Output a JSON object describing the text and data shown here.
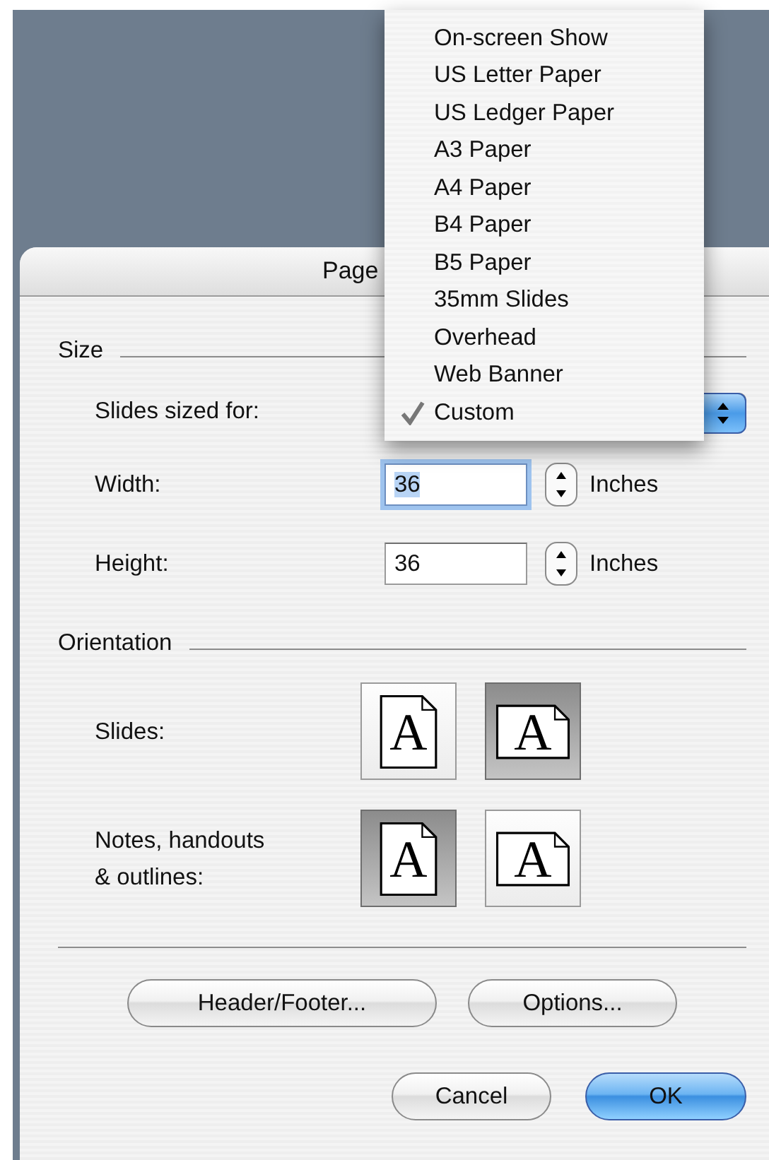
{
  "window": {
    "title": "Page"
  },
  "size_section": {
    "label": "Size",
    "slides_sized_for": {
      "label": "Slides sized for:"
    },
    "width": {
      "label": "Width:",
      "value": "36",
      "unit": "Inches",
      "focused": true
    },
    "height": {
      "label": "Height:",
      "value": "36",
      "unit": "Inches",
      "focused": false
    }
  },
  "size_menu": {
    "items": [
      {
        "label": "On-screen Show",
        "selected": false
      },
      {
        "label": "US Letter Paper",
        "selected": false
      },
      {
        "label": "US Ledger Paper",
        "selected": false
      },
      {
        "label": "A3 Paper",
        "selected": false
      },
      {
        "label": "A4 Paper",
        "selected": false
      },
      {
        "label": "B4 Paper",
        "selected": false
      },
      {
        "label": "B5 Paper",
        "selected": false
      },
      {
        "label": "35mm Slides",
        "selected": false
      },
      {
        "label": "Overhead",
        "selected": false
      },
      {
        "label": "Web Banner",
        "selected": false
      },
      {
        "label": "Custom",
        "selected": true
      }
    ]
  },
  "orientation": {
    "label": "Orientation",
    "rows": [
      {
        "label": "Slides:",
        "options": [
          {
            "kind": "portrait",
            "glyph": "A",
            "selected": false
          },
          {
            "kind": "landscape",
            "glyph": "A",
            "selected": true
          }
        ]
      },
      {
        "label": "Notes, handouts\n& outlines:",
        "options": [
          {
            "kind": "portrait",
            "glyph": "A",
            "selected": true
          },
          {
            "kind": "landscape",
            "glyph": "A",
            "selected": false
          }
        ]
      }
    ]
  },
  "buttons": [
    {
      "label": "Header/Footer...",
      "kind": "normal"
    },
    {
      "label": "Options...",
      "kind": "normal"
    },
    {
      "label": "Cancel",
      "kind": "normal"
    },
    {
      "label": "OK",
      "kind": "default"
    }
  ]
}
